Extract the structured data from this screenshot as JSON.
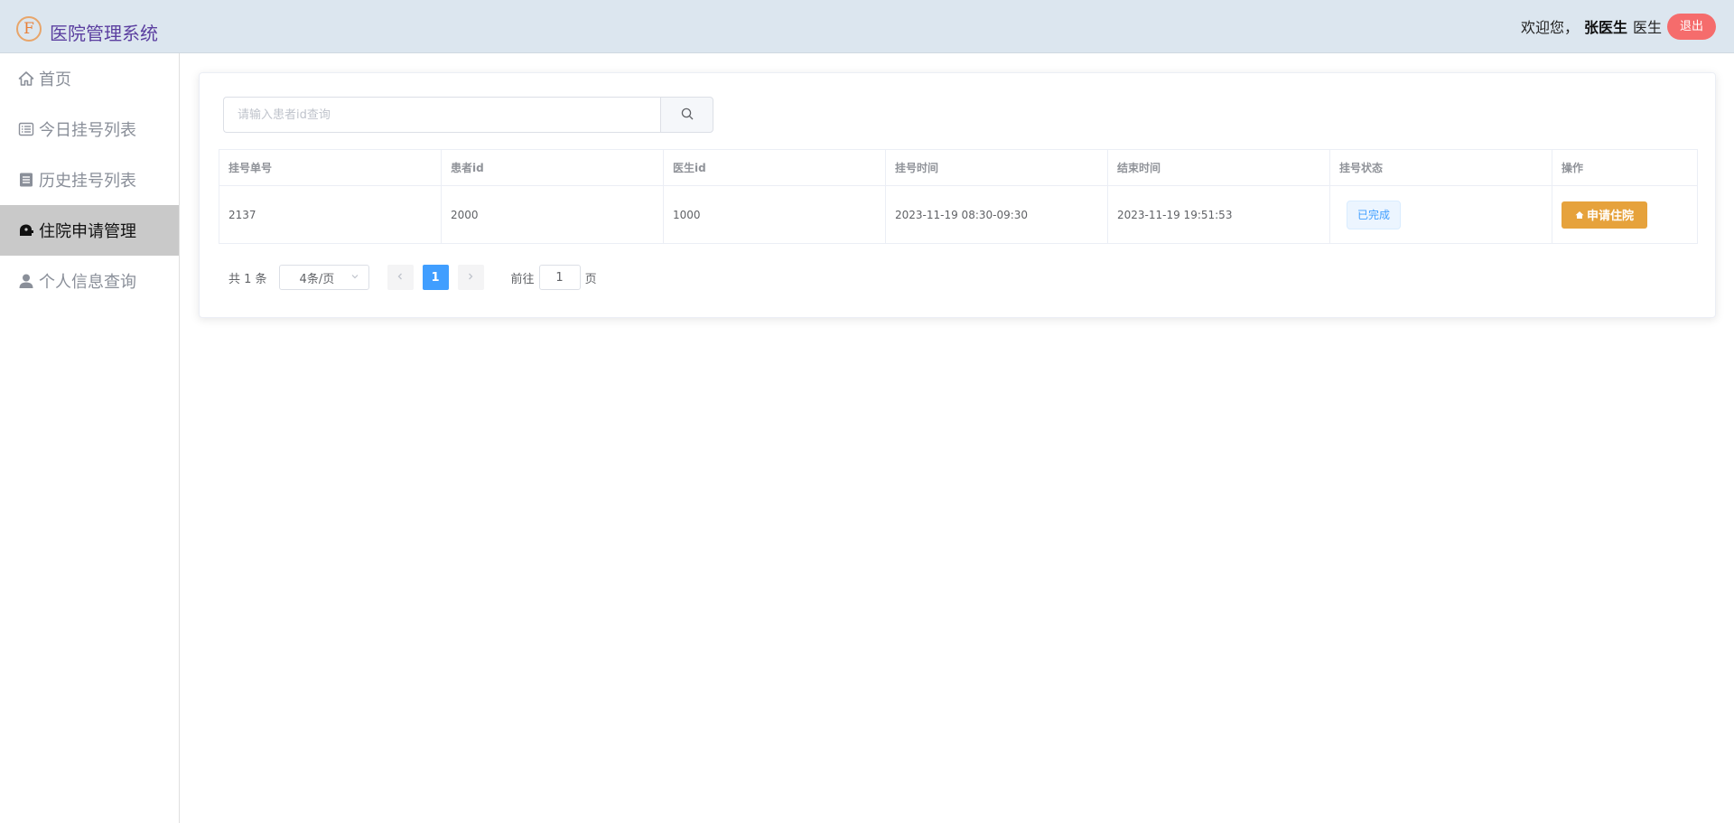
{
  "header": {
    "logo_letter": "F",
    "title": "医院管理系统",
    "welcome": "欢迎您，",
    "user_name": "张医生",
    "user_role": "医生",
    "logout_label": "退出"
  },
  "sidebar": {
    "items": [
      {
        "label": "首页",
        "icon": "home-icon"
      },
      {
        "label": "今日挂号列表",
        "icon": "list-icon"
      },
      {
        "label": "历史挂号列表",
        "icon": "document-icon"
      },
      {
        "label": "住院申请管理",
        "icon": "bed-icon",
        "active": true
      },
      {
        "label": "个人信息查询",
        "icon": "user-icon"
      }
    ]
  },
  "search": {
    "placeholder": "请输入患者id查询",
    "value": ""
  },
  "table": {
    "columns": [
      "挂号单号",
      "患者id",
      "医生id",
      "挂号时间",
      "结束时间",
      "挂号状态",
      "操作"
    ],
    "rows": [
      {
        "order_id": "2137",
        "patient_id": "2000",
        "doctor_id": "1000",
        "reg_time": "2023-11-19 08:30-09:30",
        "end_time": "2023-11-19 19:51:53",
        "status": "已完成",
        "action_label": "申请住院"
      }
    ]
  },
  "pagination": {
    "total_text": "共 1 条",
    "page_size": "4条/页",
    "current_page": "1",
    "goto_prefix": "前往",
    "goto_value": "1",
    "goto_suffix": "页"
  },
  "colors": {
    "header_bg": "#dce6ef",
    "title": "#5b3fa0",
    "logout": "#f56c6c",
    "primary": "#409eff",
    "warning": "#e6a23c",
    "active_nav_bg": "#c9c9c9"
  }
}
